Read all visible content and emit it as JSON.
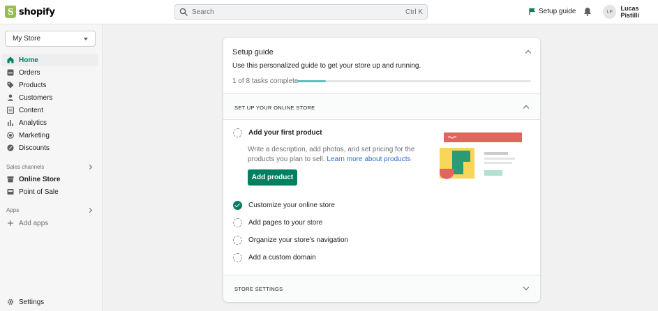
{
  "header": {
    "brand": "shopify",
    "search_placeholder": "Search",
    "search_shortcut": "Ctrl K",
    "setup_guide_label": "Setup guide",
    "user_initials": "LP",
    "user_name": "Lucas Pistilli"
  },
  "sidebar": {
    "store_name": "My Store",
    "nav": [
      {
        "label": "Home",
        "icon": "home-icon",
        "active": true
      },
      {
        "label": "Orders",
        "icon": "orders-icon"
      },
      {
        "label": "Products",
        "icon": "tag-icon"
      },
      {
        "label": "Customers",
        "icon": "person-icon"
      },
      {
        "label": "Content",
        "icon": "content-icon"
      },
      {
        "label": "Analytics",
        "icon": "bar-chart-icon"
      },
      {
        "label": "Marketing",
        "icon": "target-icon"
      },
      {
        "label": "Discounts",
        "icon": "discount-icon"
      }
    ],
    "sales_channels_label": "Sales channels",
    "channels": [
      {
        "label": "Online Store",
        "icon": "store-icon"
      },
      {
        "label": "Point of Sale",
        "icon": "pos-icon"
      }
    ],
    "apps_label": "Apps",
    "add_apps_label": "Add apps",
    "settings_label": "Settings"
  },
  "setup": {
    "title": "Setup guide",
    "subtitle": "Use this personalized guide to get your store up and running.",
    "progress_text": "1 of 8 tasks complete",
    "progress_fraction": 0.125,
    "section1_label": "SET UP YOUR ONLINE STORE",
    "current_task": {
      "title": "Add your first product",
      "description": "Write a description, add photos, and set pricing for the products you plan to sell.",
      "link": "Learn more about products",
      "button": "Add product"
    },
    "tasks": [
      {
        "label": "Customize your online store",
        "done": true
      },
      {
        "label": "Add pages to your store",
        "done": false
      },
      {
        "label": "Organize your store's navigation",
        "done": false
      },
      {
        "label": "Add a custom domain",
        "done": false
      }
    ],
    "section2_label": "STORE SETTINGS"
  },
  "colors": {
    "accent": "#008060",
    "progress": "#5bc0be",
    "link": "#2c6ecb"
  }
}
